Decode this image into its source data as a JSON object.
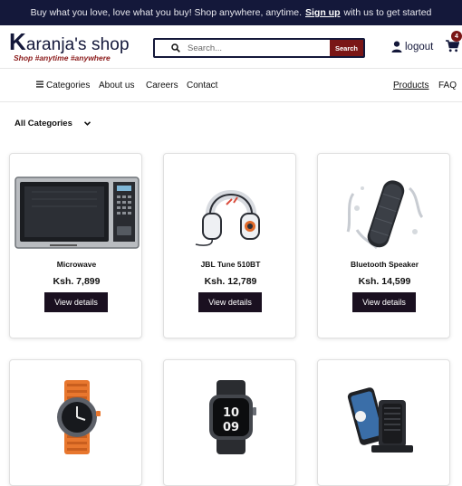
{
  "announcement": {
    "before": "Buy what you love, love what you buy! Shop anywhere, anytime.",
    "link": "Sign up",
    "after": "with us to get started"
  },
  "brand": {
    "initial": "K",
    "name": "aranja's shop",
    "tagline": "Shop #anytime #anywhere"
  },
  "search": {
    "placeholder": "Search...",
    "button": "Search"
  },
  "account": {
    "logout": "logout",
    "cart_count": "4"
  },
  "nav": {
    "categories": "Categories",
    "about": "About us",
    "careers": "Careers",
    "contact": "Contact",
    "products": "Products",
    "faq": "FAQ"
  },
  "filter": {
    "selected": "All Categories"
  },
  "products": [
    {
      "name": "Microwave",
      "price": "Ksh. 7,899",
      "button": "View details",
      "icon": "microwave-image"
    },
    {
      "name": "JBL Tune 510BT",
      "price": "Ksh. 12,789",
      "button": "View details",
      "icon": "headphones-image"
    },
    {
      "name": "Bluetooth Speaker",
      "price": "Ksh. 14,599",
      "button": "View details",
      "icon": "speaker-image"
    },
    {
      "name": "",
      "price": "",
      "button": "",
      "icon": "smartwatch-orange-image"
    },
    {
      "name": "",
      "price": "",
      "button": "",
      "icon": "smartwatch-black-image"
    },
    {
      "name": "",
      "price": "",
      "button": "",
      "icon": "wireless-charger-image"
    }
  ],
  "colors": {
    "navy": "#14183a",
    "maroon": "#7a1616",
    "button_dark": "#1a1020"
  }
}
